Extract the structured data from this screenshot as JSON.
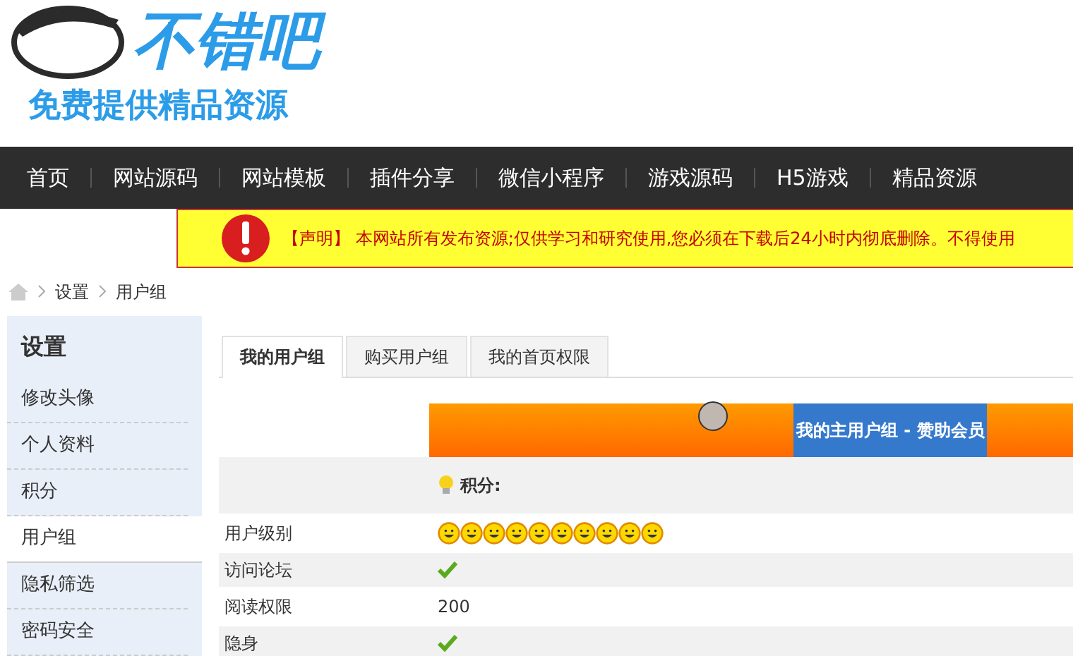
{
  "logo": {
    "title": "不错吧",
    "slogan": "免费提供精品资源"
  },
  "nav": [
    {
      "label": "首页"
    },
    {
      "label": "网站源码"
    },
    {
      "label": "网站模板"
    },
    {
      "label": "插件分享"
    },
    {
      "label": "微信小程序"
    },
    {
      "label": "游戏源码"
    },
    {
      "label": "H5游戏"
    },
    {
      "label": "精品资源"
    }
  ],
  "notice": {
    "tag": "【声明】",
    "text": "本网站所有发布资源;仅供学习和研究使用,您必须在下载后24小时内彻底删除。不得使用"
  },
  "breadcrumb": [
    "设置",
    "用户组"
  ],
  "sidebar": {
    "title": "设置",
    "items": [
      {
        "label": "修改头像",
        "selected": false
      },
      {
        "label": "个人资料",
        "selected": false
      },
      {
        "label": "积分",
        "selected": false
      },
      {
        "label": "用户组",
        "selected": true
      },
      {
        "label": "隐私筛选",
        "selected": false
      },
      {
        "label": "密码安全",
        "selected": false
      }
    ]
  },
  "tabs": [
    {
      "label": "我的用户组",
      "selected": true
    },
    {
      "label": "购买用户组",
      "selected": false
    },
    {
      "label": "我的首页权限",
      "selected": false
    }
  ],
  "group": {
    "title": "我的主用户组 - 赞助会员",
    "points_label": "积分:"
  },
  "rows": [
    {
      "label": "用户级别",
      "kind": "stars",
      "stars": 10
    },
    {
      "label": "访问论坛",
      "kind": "check"
    },
    {
      "label": "阅读权限",
      "kind": "text",
      "value": "200"
    },
    {
      "label": "隐身",
      "kind": "check"
    }
  ]
}
